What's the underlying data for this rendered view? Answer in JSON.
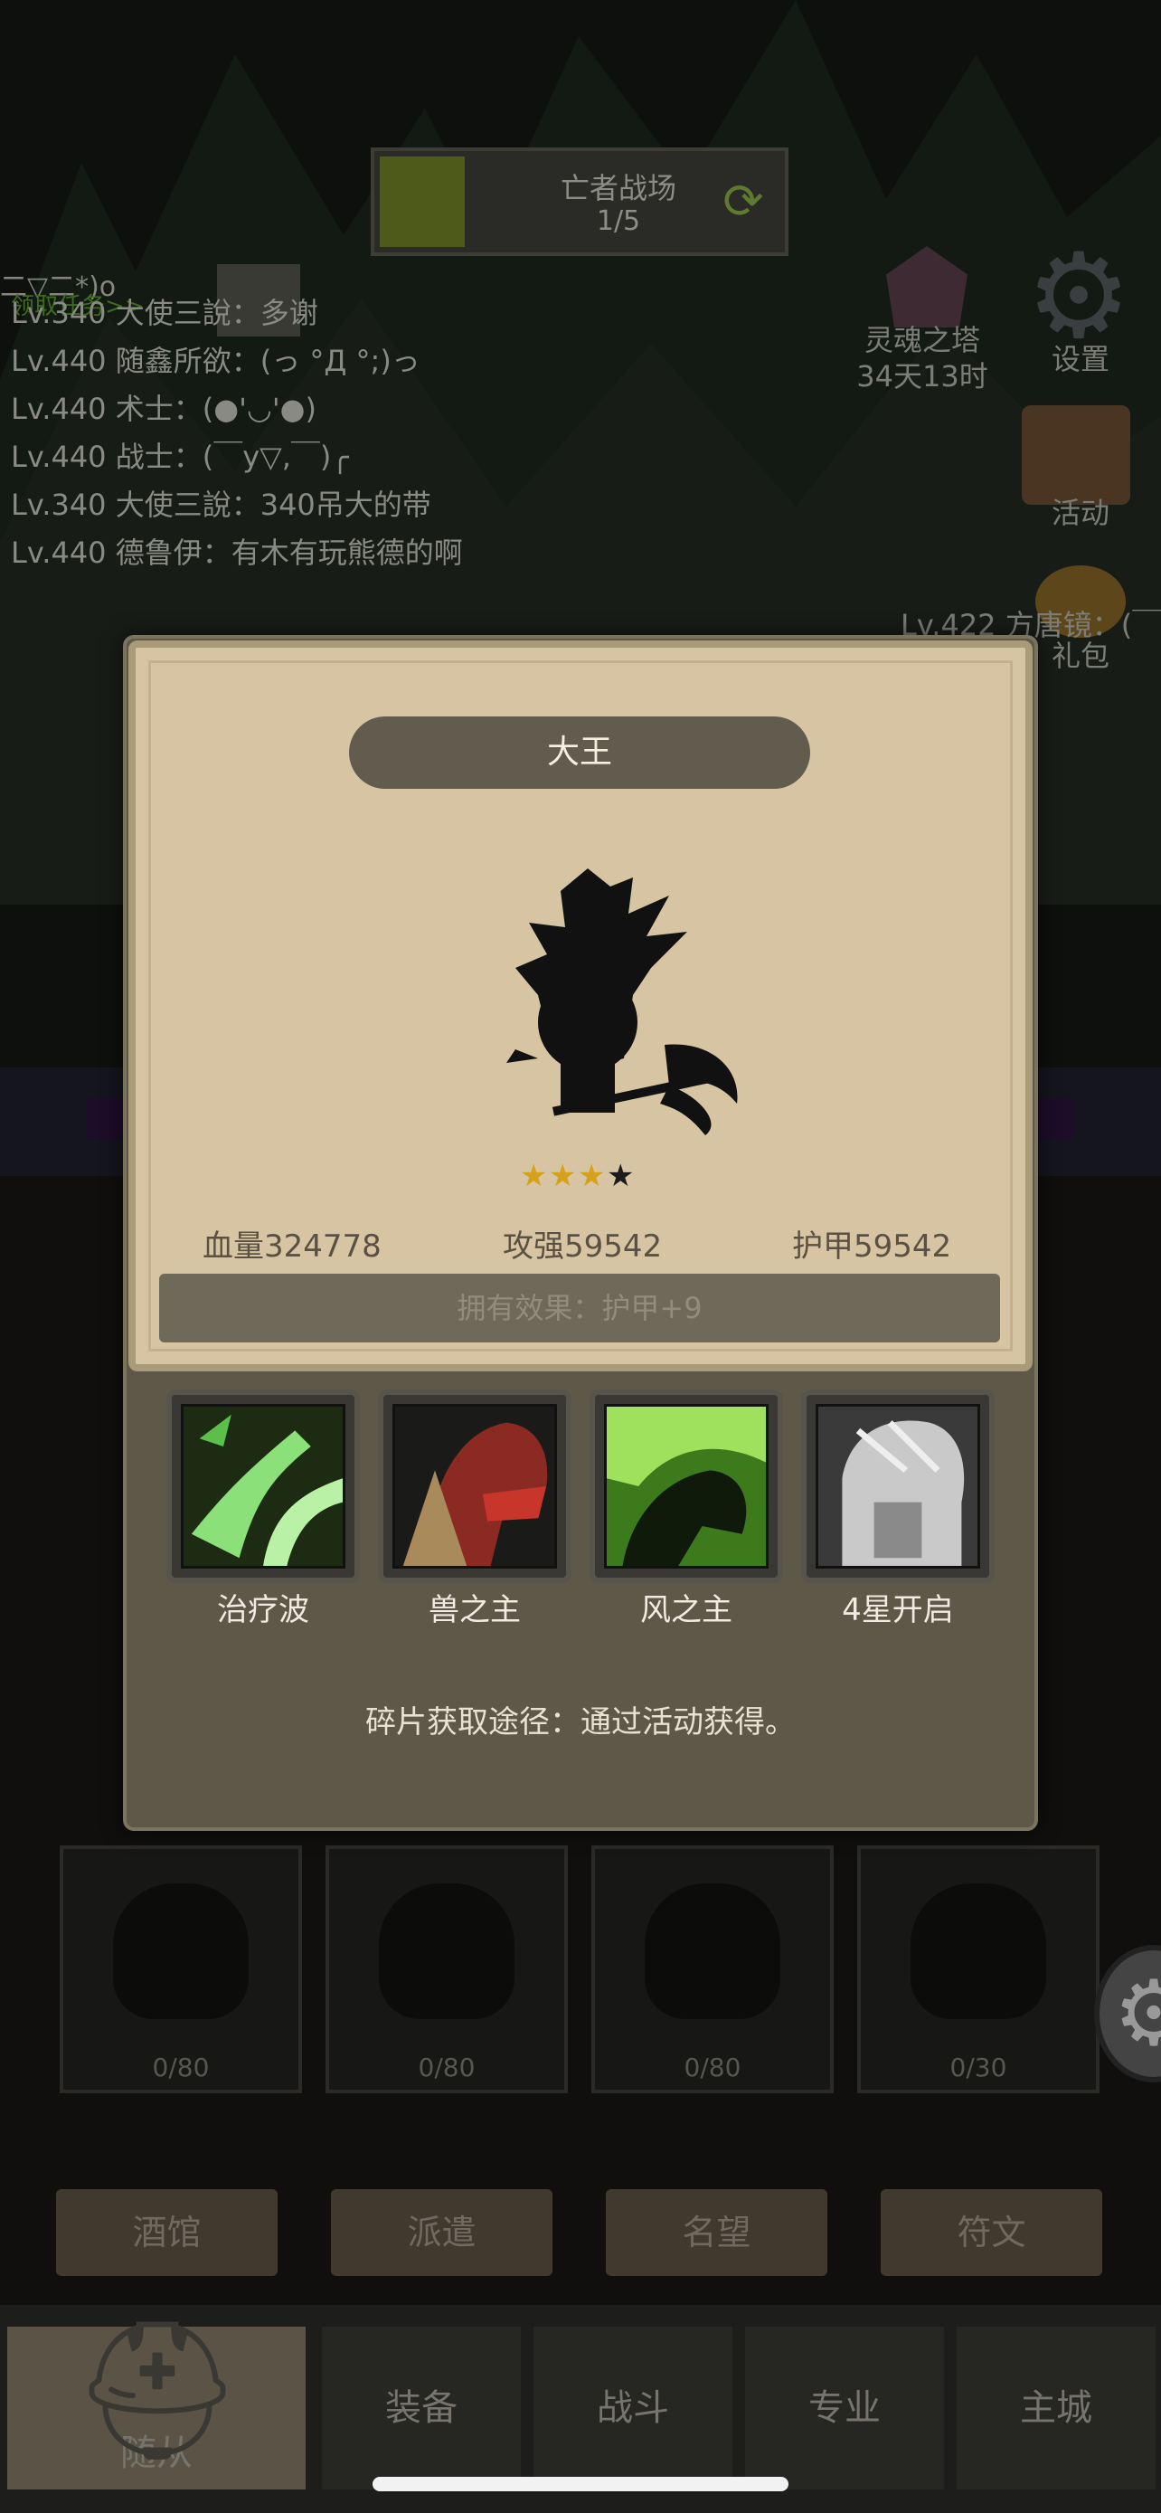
{
  "hud": {
    "battlefield_name": "亡者战场",
    "battlefield_progress": "1/5"
  },
  "quest_link": "领取任务>>",
  "chat": {
    "top_line": "二▽二*)o",
    "lines": [
      "Lv.340 大使三說：多谢",
      "Lv.440 随鑫所欲：(っ °Д °;)っ",
      "Lv.440 术士：(●'◡'●)",
      "Lv.440 战士：(￣y▽,￣)╭",
      "Lv.340 大使三說：340吊大的带",
      "Lv.440 德鲁伊：有木有玩熊德的啊"
    ],
    "notice": "Lv.422 方唐镜：(￣"
  },
  "side_menu": {
    "tower_label": "灵魂之塔",
    "tower_timer": "34天13时",
    "settings_label": "设置",
    "event_label": "活动",
    "gift_label": "礼包"
  },
  "bg_grid_counts": [
    "0/80",
    "0/80",
    "0/80",
    "0/30"
  ],
  "subtabs": [
    "酒馆",
    "派遣",
    "名望",
    "符文"
  ],
  "nav": [
    "随从",
    "装备",
    "战斗",
    "专业",
    "主城"
  ],
  "hero_card": {
    "name": "大王",
    "stars_total": 4,
    "stars_filled": 3,
    "hp_text": "血量324778",
    "atk_text": "攻强59542",
    "armor_text": "护甲59542",
    "owned_effect": "拥有效果：护甲+9",
    "skills": [
      {
        "label": "治疗波",
        "icon": "healing-wave-icon"
      },
      {
        "label": "兽之主",
        "icon": "beast-lord-icon"
      },
      {
        "label": "风之主",
        "icon": "wind-lord-icon"
      },
      {
        "label": "4星开启",
        "icon": "locked-helmet-icon"
      }
    ],
    "source_text": "碎片获取途径：通过活动获得。"
  },
  "colors": {
    "card_bg": "#d7c4a3",
    "modal_bg": "#5e5849",
    "title_pill": "#625c4f",
    "star_gold": "#d6a21e"
  }
}
